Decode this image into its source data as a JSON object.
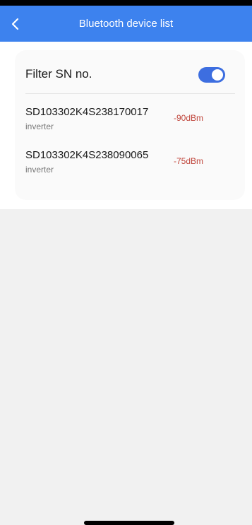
{
  "header": {
    "title": "Bluetooth device list",
    "back_icon": "chevron-left-icon",
    "background_color": "#3d82ee"
  },
  "filter": {
    "label": "Filter SN no.",
    "enabled": true,
    "toggle_color": "#3d6ee0"
  },
  "devices": [
    {
      "sn": "SD103302K4S238170017",
      "type": "inverter",
      "rssi": "-90dBm"
    },
    {
      "sn": "SD103302K4S238090065",
      "type": "inverter",
      "rssi": "-75dBm"
    }
  ],
  "colors": {
    "rssi_text": "#c0463c",
    "page_background": "#f1f1f1"
  }
}
